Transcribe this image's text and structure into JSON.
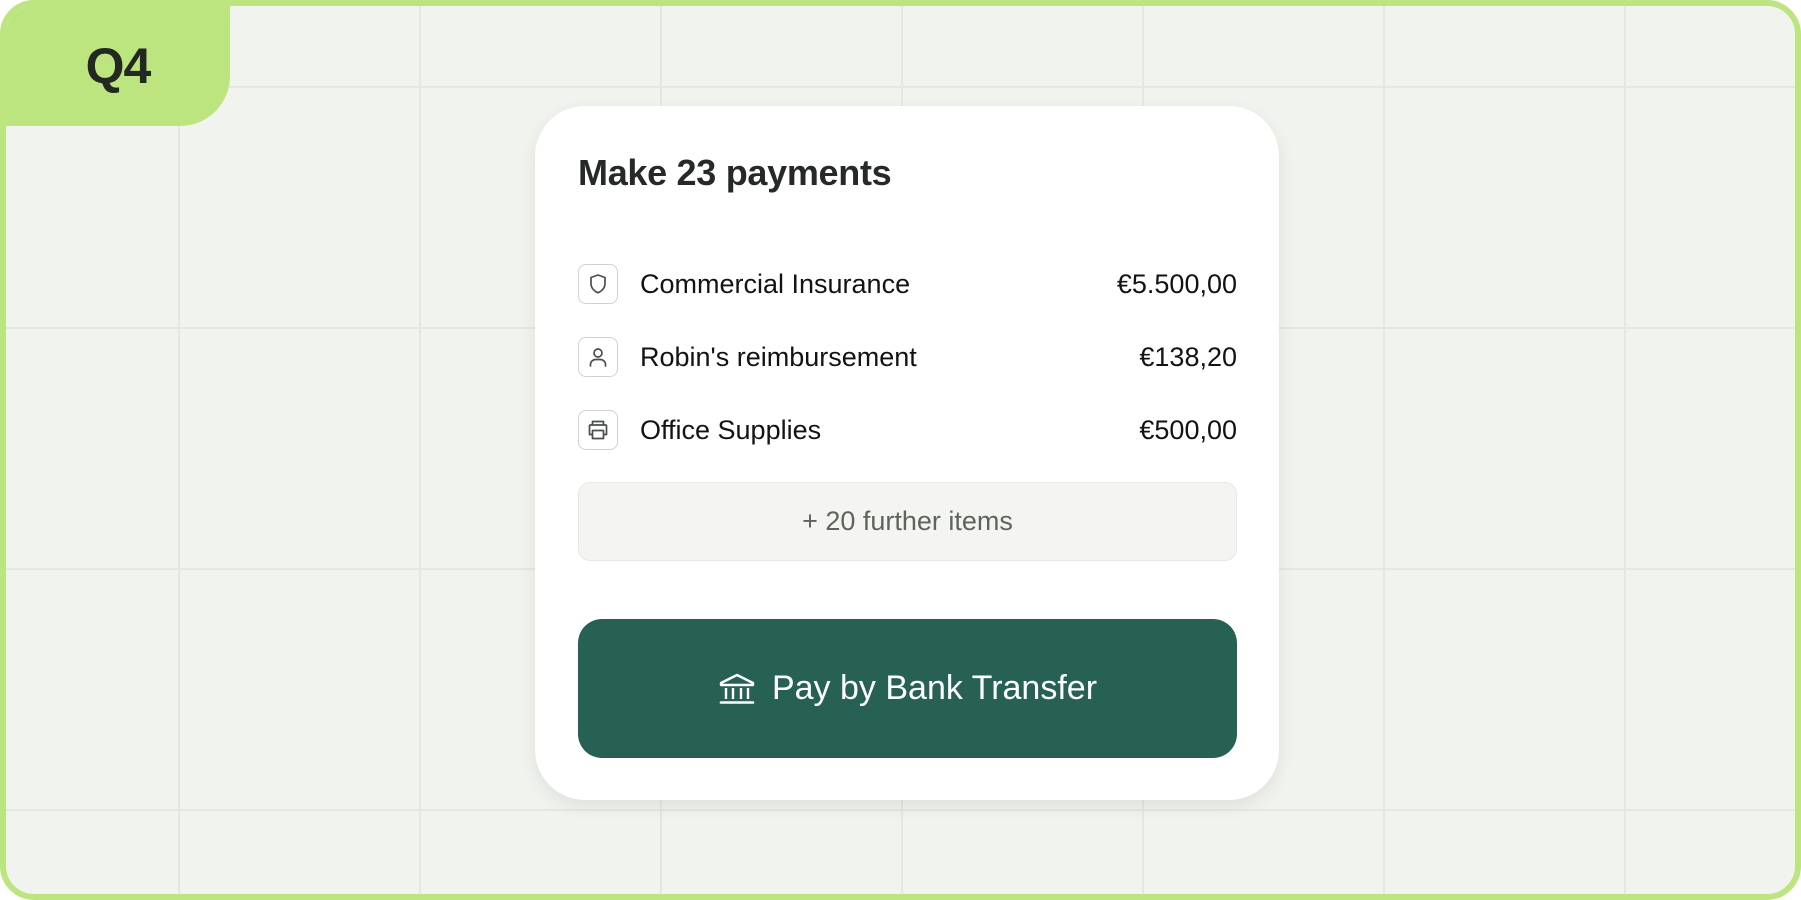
{
  "badge": {
    "label": "Q4"
  },
  "card": {
    "title": "Make 23 payments",
    "items": [
      {
        "icon": "shield-icon",
        "label": "Commercial Insurance",
        "amount": "€5.500,00"
      },
      {
        "icon": "person-icon",
        "label": "Robin's reimbursement",
        "amount": "€138,20"
      },
      {
        "icon": "printer-icon",
        "label": "Office Supplies",
        "amount": "€500,00"
      }
    ],
    "more_label": "+ 20 further items",
    "pay_button": {
      "icon": "bank-icon",
      "label": "Pay by Bank Transfer"
    }
  },
  "colors": {
    "accent_green": "#bde57f",
    "button_green": "#266153",
    "background": "#f1f3ef"
  }
}
